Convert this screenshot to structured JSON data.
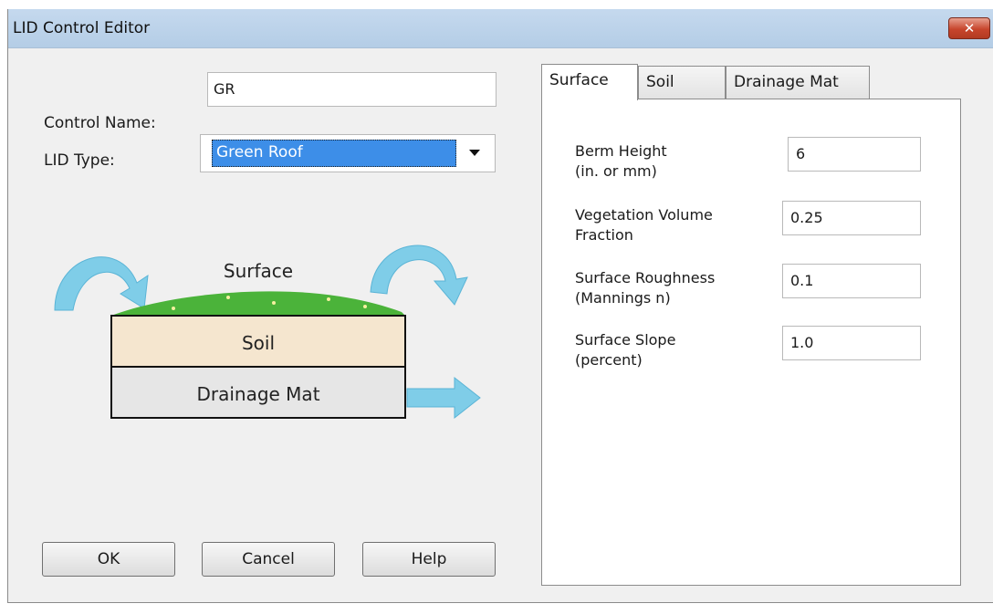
{
  "window": {
    "title": "LID Control Editor",
    "close_glyph": "✕"
  },
  "control_name": {
    "label": "Control Name:",
    "value": "GR"
  },
  "lid_type": {
    "label": "LID Type:",
    "value": "Green Roof"
  },
  "illustration": {
    "surface_label": "Surface",
    "soil_label": "Soil",
    "drainage_label": "Drainage Mat"
  },
  "buttons": {
    "ok": "OK",
    "cancel": "Cancel",
    "help": "Help"
  },
  "tabs": [
    {
      "label": "Surface",
      "active": true
    },
    {
      "label": "Soil",
      "active": false
    },
    {
      "label": "Drainage Mat",
      "active": false
    }
  ],
  "surface_params": [
    {
      "line1": "Berm Height",
      "line2": "(in. or mm)",
      "value": "6"
    },
    {
      "line1": "Vegetation Volume",
      "line2": "Fraction",
      "value": "0.25"
    },
    {
      "line1": "Surface Roughness",
      "line2": "(Mannings n)",
      "value": "0.1"
    },
    {
      "line1": "Surface Slope",
      "line2": "(percent)",
      "value": "1.0"
    }
  ],
  "colors": {
    "title_bar": "#b4cde6",
    "close_button": "#c7452c",
    "selection": "#3d8ee8",
    "grass": "#4bb33a",
    "soil": "#f5e6cf",
    "drainage": "#e6e6e6",
    "arrow": "#7fcde8"
  }
}
